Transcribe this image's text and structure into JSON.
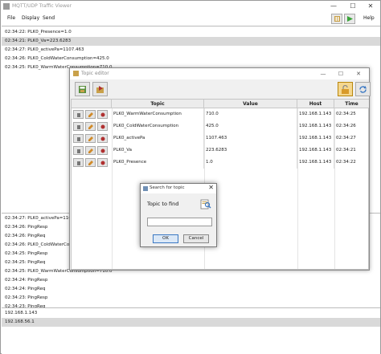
{
  "app": {
    "title": "MQTT/UDP Traffic Viewer",
    "menu": [
      "File",
      "Display",
      "Send"
    ],
    "help_label": "Help",
    "minimize": "—",
    "maximize": "☐",
    "close": "✕",
    "colors": {
      "accent": "#3a78c3",
      "selection": "#d9d9d9",
      "pause": "#c9a14a",
      "play": "#3aa33a"
    }
  },
  "log_top": [
    "02:34:22:  PLK0_Presence=1.0",
    "02:34:21:  PLK0_Va=223.6283",
    "02:34:27:  PLK0_activePa=1107.463",
    "02:34:26:  PLK0_ColdWaterConsumption=425.0",
    "02:34:25:  PLK0_WarmWaterConsumption=710.0"
  ],
  "log_bottom": [
    "02:34:27:  PLK0_activePa=1107.46",
    "02:34:26:  PingResp",
    "02:34:26:  PingReq",
    "02:34:26:  PLK0_ColdWaterConsumption",
    "02:34:25:  PingResp",
    "02:34:25:  PingReq",
    "02:34:25:  PLK0_WarmWaterConsumption=710.0",
    "02:34:24:  PingResp",
    "02:34:24:  PingReq",
    "02:34:23:  PingResp",
    "02:34:23:  PingReq"
  ],
  "hosts": [
    "192.168.1.143",
    "192.168.56.1"
  ],
  "editor": {
    "title": "Topic editor",
    "columns": [
      "Topic",
      "Value",
      "Host",
      "Time"
    ],
    "rows": [
      {
        "topic": "PLK0_WarmWaterConsumption",
        "value": "710.0",
        "host": "192.168.1.143",
        "time": "02:34:25"
      },
      {
        "topic": "PLK0_ColdWaterConsumption",
        "value": "425.0",
        "host": "192.168.1.143",
        "time": "02:34:26"
      },
      {
        "topic": "PLK0_activePa",
        "value": "1107.463",
        "host": "192.168.1.143",
        "time": "02:34:27"
      },
      {
        "topic": "PLK0_Va",
        "value": "223.6283",
        "host": "192.168.1.143",
        "time": "02:34:21"
      },
      {
        "topic": "PLK0_Presence",
        "value": "1.0",
        "host": "192.168.1.143",
        "time": "02:34:22"
      }
    ]
  },
  "search": {
    "title": "Search for topic",
    "label": "Topic to find",
    "value": "",
    "ok_label": "OK",
    "cancel_label": "Cancel"
  }
}
